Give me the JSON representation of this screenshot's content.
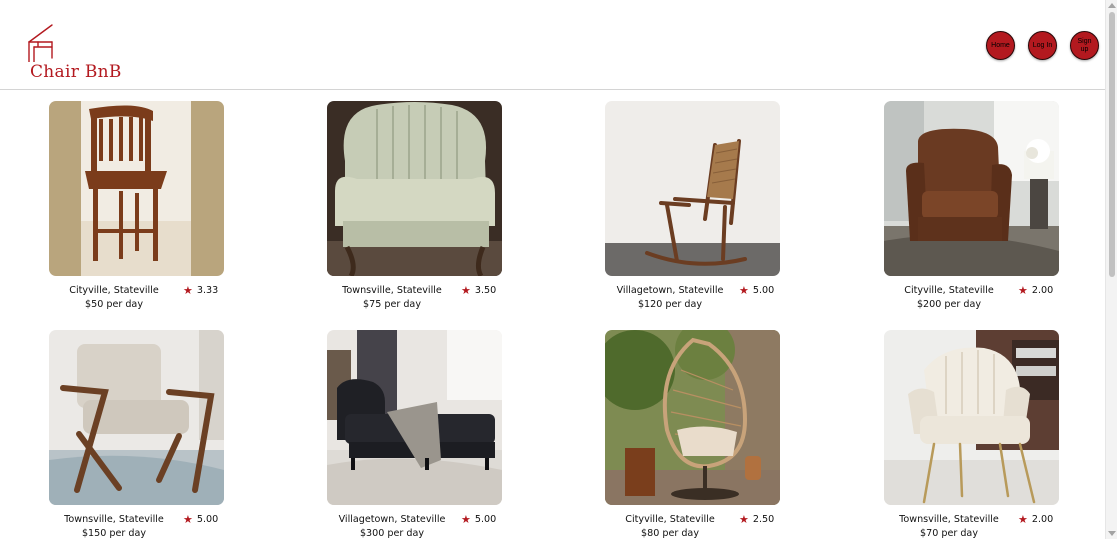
{
  "app": {
    "name": "Chair BnB",
    "accent_color": "#b3191f"
  },
  "nav": {
    "home": "Home",
    "login": "Log In",
    "signup": "Sign up"
  },
  "listings": [
    {
      "location": "Cityville, Stateville",
      "price": "$50 per day",
      "rating": "3.33",
      "image": "wooden swivel bar stool"
    },
    {
      "location": "Townsville, Stateville",
      "price": "$75 per day",
      "rating": "3.50",
      "image": "floral wingback armchair"
    },
    {
      "location": "Villagetown, Stateville",
      "price": "$120 per day",
      "rating": "5.00",
      "image": "wooden rocking chair"
    },
    {
      "location": "Cityville, Stateville",
      "price": "$200 per day",
      "rating": "2.00",
      "image": "brown leather recliner"
    },
    {
      "location": "Townsville, Stateville",
      "price": "$150 per day",
      "rating": "5.00",
      "image": "mid-century wood lounge chair"
    },
    {
      "location": "Villagetown, Stateville",
      "price": "$300 per day",
      "rating": "5.00",
      "image": "black chaise lounge"
    },
    {
      "location": "Cityville, Stateville",
      "price": "$80 per day",
      "rating": "2.50",
      "image": "hanging egg swing chair"
    },
    {
      "location": "Townsville, Stateville",
      "price": "$70 per day",
      "rating": "2.00",
      "image": "cream velvet accent chair"
    }
  ],
  "icons": {
    "logo": "chair-logo-icon",
    "rating": "star-icon"
  }
}
